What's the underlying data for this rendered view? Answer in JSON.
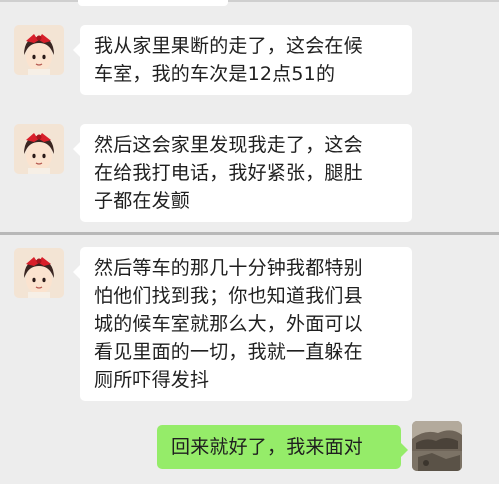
{
  "chat": {
    "messages": [
      {
        "sender": "other",
        "avatar": "anime-girl-red-bow-avatar",
        "lines": [
          "我从家里果断的走了，这会在候",
          "车室，我的车次是12点51的"
        ]
      },
      {
        "sender": "other",
        "avatar": "anime-girl-red-bow-avatar",
        "lines": [
          "然后这会家里发现我走了，这会",
          "在给我打电话，我好紧张，腿肚",
          "子都在发颤"
        ]
      },
      {
        "sender": "other",
        "avatar": "anime-girl-red-bow-avatar",
        "lines": [
          "然后等车的那几十分钟我都特别",
          "怕他们找到我；你也知道我们县",
          "城的候车室就那么大，外面可以",
          "看见里面的一切，我就一直躲在",
          "厕所吓得发抖"
        ]
      },
      {
        "sender": "me",
        "avatar": "photo-avatar",
        "lines": [
          "回来就好了，我来面对"
        ]
      }
    ]
  },
  "colors": {
    "background": "#ededed",
    "bubble_other": "#ffffff",
    "bubble_me": "#95ec69",
    "text": "#1f1f1f"
  }
}
